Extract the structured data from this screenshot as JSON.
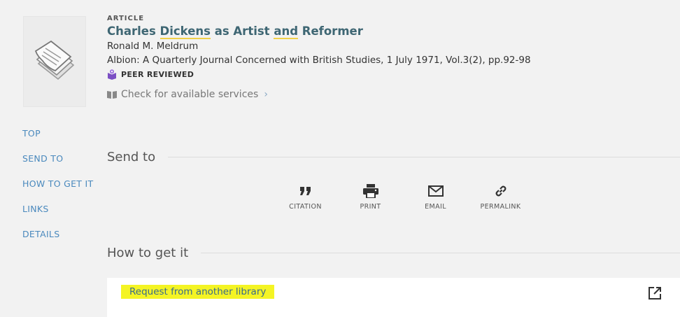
{
  "record": {
    "type": "ARTICLE",
    "title_parts": [
      "Charles ",
      "Dickens",
      " as Artist ",
      "and",
      " Reformer"
    ],
    "author": "Ronald M. Meldrum",
    "source": "Albion: A Quarterly Journal Concerned with British Studies, 1 July 1971, Vol.3(2), pp.92-98",
    "peer_reviewed": "PEER REVIEWED",
    "check_services": "Check for available services",
    "check_chevron": "›"
  },
  "nav": [
    "TOP",
    "SEND TO",
    "HOW TO GET IT",
    "LINKS",
    "DETAILS"
  ],
  "send_to": {
    "title": "Send to",
    "actions": [
      {
        "label": "CITATION",
        "icon": "quote-icon"
      },
      {
        "label": "PRINT",
        "icon": "printer-icon"
      },
      {
        "label": "EMAIL",
        "icon": "envelope-icon"
      },
      {
        "label": "PERMALINK",
        "icon": "link-icon"
      }
    ]
  },
  "how_to_get_it": {
    "title": "How to get it",
    "request_link": "Request from another library",
    "external_icon": "external-link-icon"
  },
  "colors": {
    "link": "#4a89bd",
    "title": "#3e6673",
    "highlight": "#f4f424",
    "peer_badge": "#7b4fc4"
  }
}
